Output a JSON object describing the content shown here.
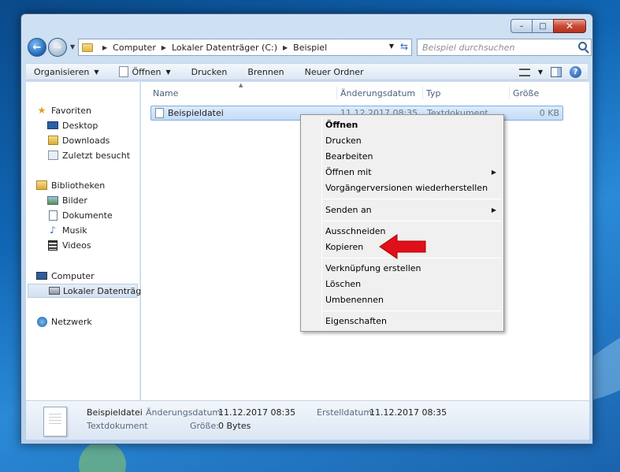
{
  "window": {
    "controls": {
      "minimize": "–",
      "maximize": "□",
      "close": "✕"
    }
  },
  "address_bar": {
    "breadcrumbs": [
      "Computer",
      "Lokaler Datenträger (C:)",
      "Beispiel"
    ]
  },
  "search": {
    "placeholder": "Beispiel durchsuchen"
  },
  "toolbar": {
    "items": [
      "Organisieren",
      "Öffnen",
      "Drucken",
      "Brennen",
      "Neuer Ordner"
    ]
  },
  "nav_pane": {
    "favorites_label": "Favoriten",
    "favorites": [
      "Desktop",
      "Downloads",
      "Zuletzt besucht"
    ],
    "libraries_label": "Bibliotheken",
    "libraries": [
      "Bilder",
      "Dokumente",
      "Musik",
      "Videos"
    ],
    "computer_label": "Computer",
    "computer_items": [
      "Lokaler Datenträger"
    ],
    "network_label": "Netzwerk"
  },
  "file_list": {
    "columns": [
      "Name",
      "Änderungsdatum",
      "Typ",
      "Größe"
    ],
    "rows": [
      {
        "name": "Beispieldatei",
        "date": "11.12.2017 08:35",
        "type": "Textdokument",
        "size": "0 KB"
      }
    ]
  },
  "context_menu": {
    "items": [
      "Öffnen",
      "Drucken",
      "Bearbeiten",
      "Öffnen mit",
      "Vorgängerversionen wiederherstellen",
      "Senden an",
      "Ausschneiden",
      "Kopieren",
      "Verknüpfung erstellen",
      "Löschen",
      "Umbenennen",
      "Eigenschaften"
    ],
    "submenu_arrow": "▶"
  },
  "details_pane": {
    "file_name": "Beispieldatei",
    "file_type": "Textdokument",
    "modified_label": "Änderungsdatum:",
    "modified_value": "11.12.2017 08:35",
    "created_label": "Erstelldatum:",
    "created_value": "11.12.2017 08:35",
    "size_label": "Größe:",
    "size_value": "0 Bytes"
  },
  "colors": {
    "annotation_arrow": "#e0101a",
    "selection": "#c4dcf7"
  }
}
